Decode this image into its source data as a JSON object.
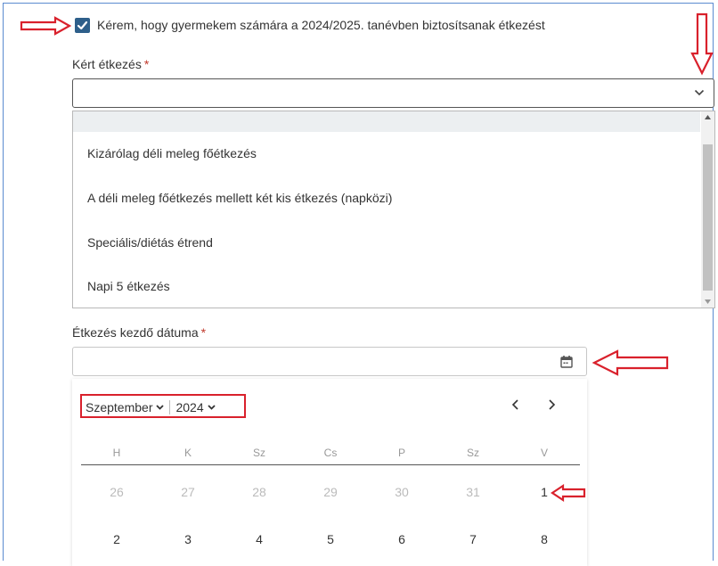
{
  "agreement": {
    "checked": true,
    "label": "Kérem, hogy gyermekem számára a 2024/2025. tanévben biztosítsanak étkezést"
  },
  "meal_field": {
    "label": "Kért étkezés",
    "required_mark": "*",
    "value": "",
    "options": [
      "Kizárólag déli meleg főétkezés",
      "A déli meleg főétkezés mellett két kis étkezés (napközi)",
      "Speciális/diétás étrend",
      "Napi 5 étkezés"
    ]
  },
  "date_field": {
    "label": "Étkezés kezdő dátuma",
    "required_mark": "*",
    "value": ""
  },
  "calendar": {
    "month": "Szeptember",
    "year": "2024",
    "weekdays": [
      "H",
      "K",
      "Sz",
      "Cs",
      "P",
      "Sz",
      "V"
    ],
    "rows": [
      [
        "26",
        "27",
        "28",
        "29",
        "30",
        "31",
        "1"
      ],
      [
        "2",
        "3",
        "4",
        "5",
        "6",
        "7",
        "8"
      ]
    ]
  },
  "colors": {
    "checkbox": "#2e5f8a",
    "annotation_red": "#d9212c",
    "required_star": "#c0392b"
  }
}
